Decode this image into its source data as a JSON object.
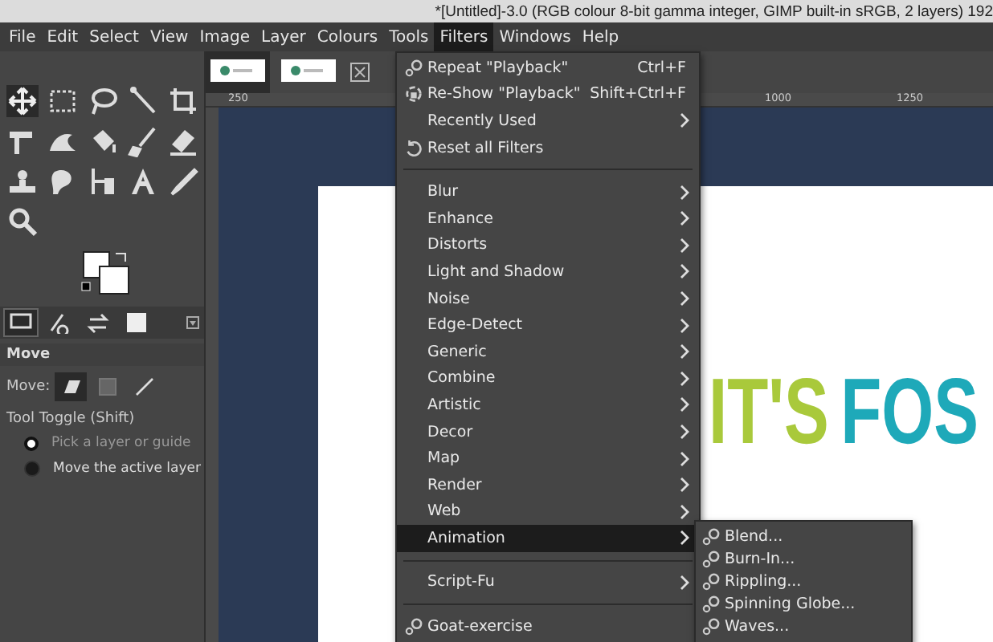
{
  "window": {
    "title": "*[Untitled]-3.0 (RGB colour 8-bit gamma integer, GIMP built-in sRGB, 2 layers) 192"
  },
  "menubar": [
    {
      "label": "File",
      "selected": false
    },
    {
      "label": "Edit",
      "selected": false
    },
    {
      "label": "Select",
      "selected": false
    },
    {
      "label": "View",
      "selected": false
    },
    {
      "label": "Image",
      "selected": false
    },
    {
      "label": "Layer",
      "selected": false
    },
    {
      "label": "Colours",
      "selected": false
    },
    {
      "label": "Tools",
      "selected": false
    },
    {
      "label": "Filters",
      "selected": true
    },
    {
      "label": "Windows",
      "selected": false
    },
    {
      "label": "Help",
      "selected": false
    }
  ],
  "image_tabs": [
    {
      "selected": true
    },
    {
      "selected": false
    }
  ],
  "tool_options": {
    "tabs": [
      {
        "selected": true
      },
      {
        "selected": false
      },
      {
        "selected": false
      },
      {
        "selected": false
      }
    ],
    "title": "Move",
    "move_label": "Move:",
    "move_modes": [
      {
        "selected": true
      },
      {
        "selected": false
      },
      {
        "selected": false
      }
    ],
    "toggle_label": "Tool Toggle (Shift)",
    "options": [
      {
        "label": "Pick a layer or guide",
        "selected": true
      },
      {
        "label": "Move the active layer",
        "selected": false
      }
    ]
  },
  "ruler_labels": [
    "250",
    "1000",
    "1250"
  ],
  "canvas_words": [
    {
      "text": "IT'S",
      "color": "#a9c93b"
    },
    {
      "text": "FOS",
      "color": "#1ea9b9"
    }
  ],
  "filters_menu": [
    {
      "kind": "repeat",
      "label": "Repeat \"Playback\"",
      "shortcut": "Ctrl+F",
      "submenu": false,
      "selected": false
    },
    {
      "kind": "reshow",
      "label": "Re-Show \"Playback\"",
      "shortcut": "Shift+Ctrl+F",
      "submenu": false,
      "selected": false
    },
    {
      "kind": "plain",
      "label": "Recently Used",
      "submenu": true,
      "selected": false
    },
    {
      "kind": "reset",
      "label": "Reset all Filters",
      "submenu": false,
      "selected": false
    },
    {
      "kind": "separator"
    },
    {
      "kind": "plain",
      "label": "Blur",
      "submenu": true,
      "selected": false
    },
    {
      "kind": "plain",
      "label": "Enhance",
      "submenu": true,
      "selected": false
    },
    {
      "kind": "plain",
      "label": "Distorts",
      "submenu": true,
      "selected": false
    },
    {
      "kind": "plain",
      "label": "Light and Shadow",
      "submenu": true,
      "selected": false
    },
    {
      "kind": "plain",
      "label": "Noise",
      "submenu": true,
      "selected": false
    },
    {
      "kind": "plain",
      "label": "Edge-Detect",
      "submenu": true,
      "selected": false
    },
    {
      "kind": "plain",
      "label": "Generic",
      "submenu": true,
      "selected": false
    },
    {
      "kind": "plain",
      "label": "Combine",
      "submenu": true,
      "selected": false
    },
    {
      "kind": "plain",
      "label": "Artistic",
      "submenu": true,
      "selected": false
    },
    {
      "kind": "plain",
      "label": "Decor",
      "submenu": true,
      "selected": false
    },
    {
      "kind": "plain",
      "label": "Map",
      "submenu": true,
      "selected": false
    },
    {
      "kind": "plain",
      "label": "Render",
      "submenu": true,
      "selected": false
    },
    {
      "kind": "plain",
      "label": "Web",
      "submenu": true,
      "selected": false
    },
    {
      "kind": "plain",
      "label": "Animation",
      "submenu": true,
      "selected": true
    },
    {
      "kind": "separator"
    },
    {
      "kind": "plain",
      "label": "Script-Fu",
      "submenu": true,
      "selected": false
    },
    {
      "kind": "separator"
    },
    {
      "kind": "plugin",
      "label": "Goat-exercise",
      "submenu": false,
      "selected": false
    }
  ],
  "animation_submenu": [
    {
      "label": "Blend..."
    },
    {
      "label": "Burn-In..."
    },
    {
      "label": "Rippling..."
    },
    {
      "label": "Spinning Globe..."
    },
    {
      "label": "Waves..."
    }
  ]
}
